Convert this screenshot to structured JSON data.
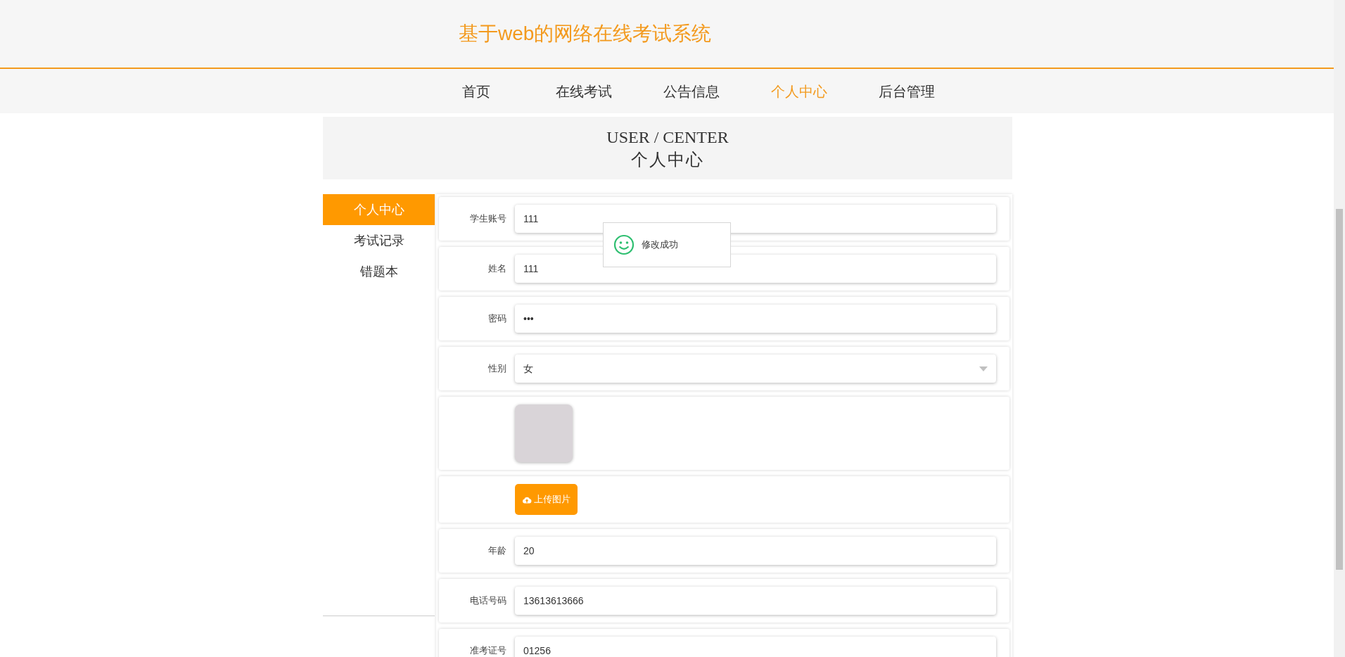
{
  "header": {
    "title": "基于web的网络在线考试系统"
  },
  "nav": [
    {
      "label": "首页",
      "selected": false
    },
    {
      "label": "在线考试",
      "selected": false
    },
    {
      "label": "公告信息",
      "selected": false
    },
    {
      "label": "个人中心",
      "selected": true
    },
    {
      "label": "后台管理",
      "selected": false
    }
  ],
  "banner": {
    "title": "USER / CENTER",
    "subtitle": "个人中心"
  },
  "sidebar": {
    "items": [
      {
        "label": "个人中心",
        "selected": true
      },
      {
        "label": "考试记录",
        "selected": false
      },
      {
        "label": "错题本",
        "selected": false
      }
    ]
  },
  "form": {
    "fields": [
      {
        "kind": "text",
        "label": "学生账号",
        "value": "111"
      },
      {
        "kind": "text",
        "label": "姓名",
        "value": "111"
      },
      {
        "kind": "text",
        "label": "密码",
        "value": "•••"
      },
      {
        "kind": "select",
        "label": "性别",
        "value": "女"
      },
      {
        "kind": "image"
      },
      {
        "kind": "upload",
        "button": "上传图片"
      },
      {
        "kind": "text",
        "label": "年龄",
        "value": "20"
      },
      {
        "kind": "text",
        "label": "电话号码",
        "value": "13613613666"
      },
      {
        "kind": "text",
        "label": "准考证号",
        "value": "01256"
      }
    ]
  },
  "toast": {
    "message": "修改成功"
  }
}
